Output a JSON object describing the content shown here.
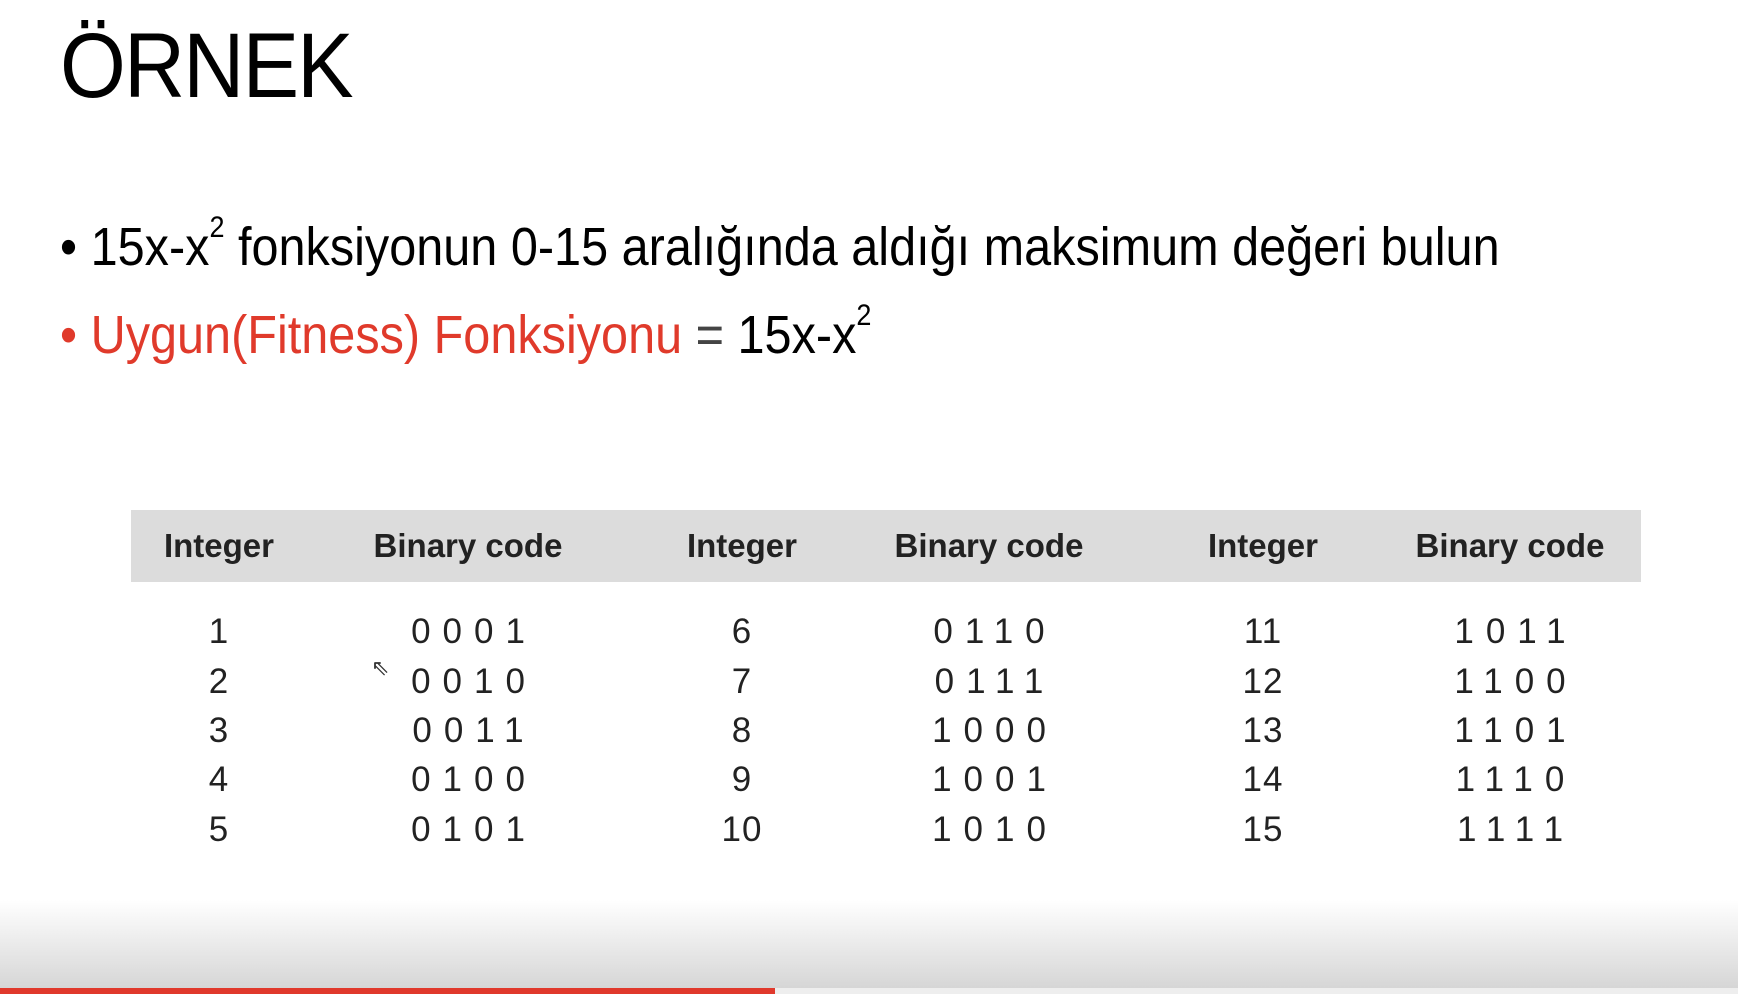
{
  "slide": {
    "title": "ÖRNEK",
    "bullet1": {
      "prefix": "15x-x",
      "sup": "2",
      "rest": " fonksiyonun 0-15 aralığında aldığı maksimum değeri bulun"
    },
    "bullet2": {
      "red": "Uygun(Fitness) Fonksiyonu",
      "eq": " = ",
      "expr": "15x-x",
      "sup": "2"
    },
    "colors": {
      "accent": "#e03a2b",
      "header_bg": "#dcdcdc"
    }
  },
  "table": {
    "headers": [
      "Integer",
      "Binary code",
      "Integer",
      "Binary code",
      "Integer",
      "Binary code"
    ],
    "rows": [
      [
        "1",
        "0001",
        "6",
        "0110",
        "11",
        "1011"
      ],
      [
        "2",
        "0010",
        "7",
        "0111",
        "12",
        "1100"
      ],
      [
        "3",
        "0011",
        "8",
        "1000",
        "13",
        "1101"
      ],
      [
        "4",
        "0100",
        "9",
        "1001",
        "14",
        "1110"
      ],
      [
        "5",
        "0101",
        "10",
        "1010",
        "15",
        "1111"
      ]
    ]
  },
  "player": {
    "progress_percent": 44.6,
    "progress_color": "#e0392c"
  }
}
